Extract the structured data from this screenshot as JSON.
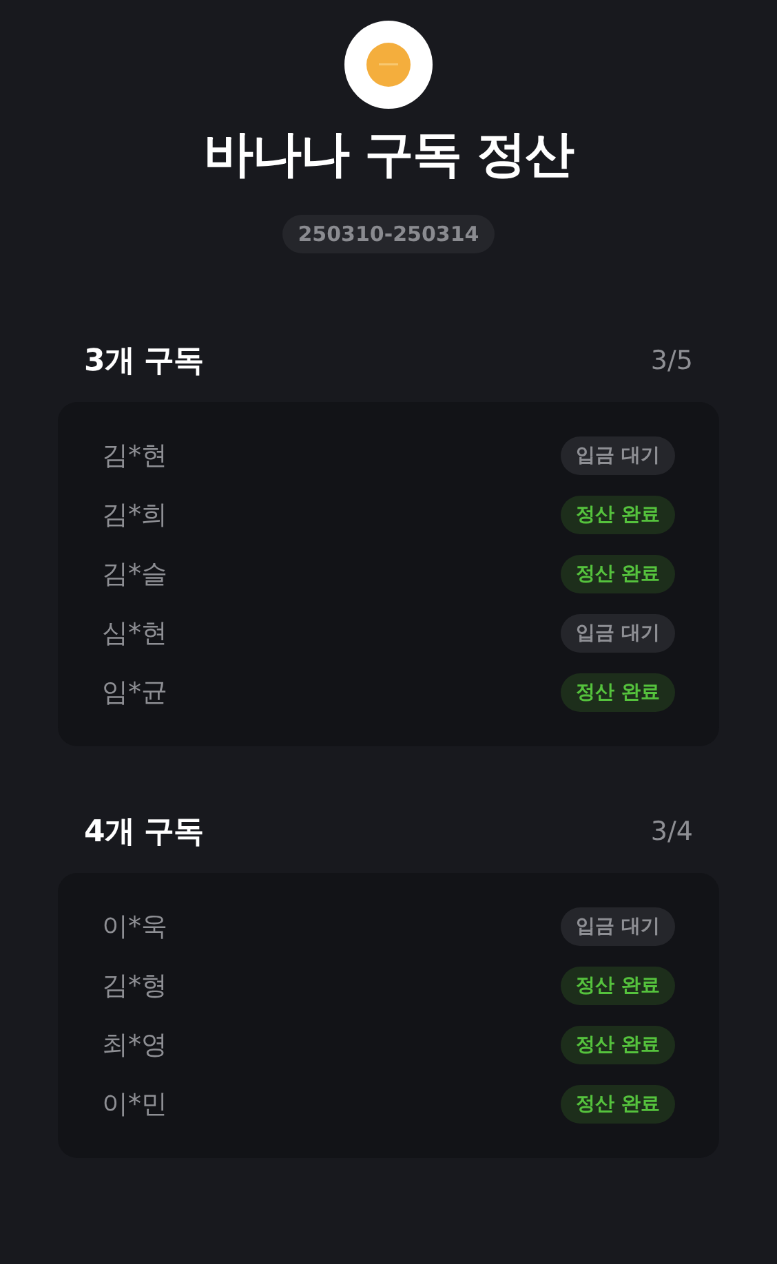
{
  "title": "바나나 구독 정산",
  "period": "250310-250314",
  "groups": [
    {
      "title": "3개 구독",
      "count": "3/5",
      "members": [
        {
          "name": "김*현",
          "status": "입금 대기",
          "kind": "waiting"
        },
        {
          "name": "김*희",
          "status": "정산 완료",
          "kind": "done"
        },
        {
          "name": "김*슬",
          "status": "정산 완료",
          "kind": "done"
        },
        {
          "name": "심*현",
          "status": "입금 대기",
          "kind": "waiting"
        },
        {
          "name": "임*균",
          "status": "정산 완료",
          "kind": "done"
        }
      ]
    },
    {
      "title": "4개 구독",
      "count": "3/4",
      "members": [
        {
          "name": "이*욱",
          "status": "입금 대기",
          "kind": "waiting"
        },
        {
          "name": "김*형",
          "status": "정산 완료",
          "kind": "done"
        },
        {
          "name": "최*영",
          "status": "정산 완료",
          "kind": "done"
        },
        {
          "name": "이*민",
          "status": "정산 완료",
          "kind": "done"
        }
      ]
    }
  ]
}
